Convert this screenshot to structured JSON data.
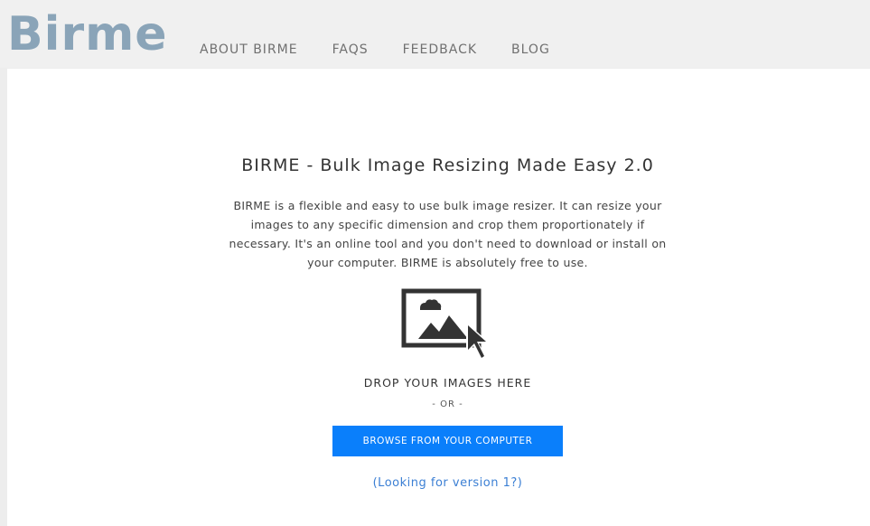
{
  "header": {
    "logo_text": "Birme",
    "nav": [
      {
        "label": "ABOUT BIRME"
      },
      {
        "label": "FAQS"
      },
      {
        "label": "FEEDBACK"
      },
      {
        "label": "BLOG"
      }
    ]
  },
  "main": {
    "title": "BIRME - Bulk Image Resizing Made Easy 2.0",
    "description": "BIRME is a flexible and easy to use bulk image resizer. It can resize your images to any specific dimension and crop them proportionately if necessary. It's an online tool and you don't need to download or install on your computer. BIRME is absolutely free to use.",
    "drop_icon": "image-drop-icon",
    "drop_label": "DROP YOUR IMAGES HERE",
    "or_label": "- OR -",
    "browse_button_label": "BROWSE FROM YOUR COMPUTER",
    "version_link_label": "(Looking for version 1?)"
  },
  "colors": {
    "logo": "#8aa4b8",
    "accent_button": "#0a7ffb",
    "link": "#3b7fd4",
    "header_bg": "#f0f0f0"
  }
}
